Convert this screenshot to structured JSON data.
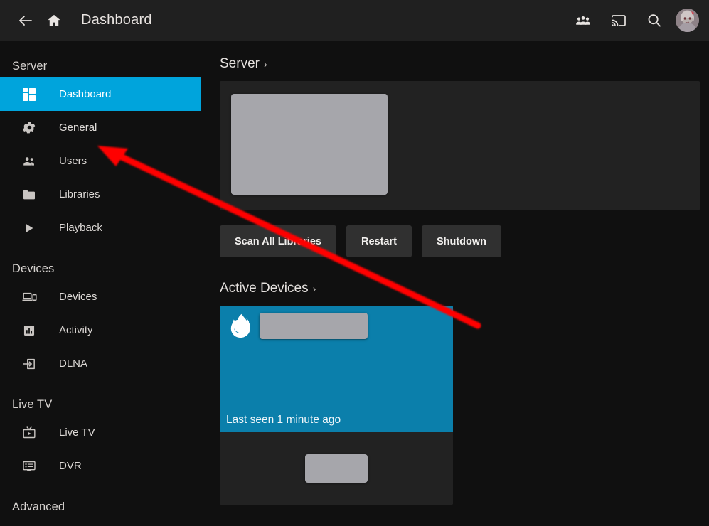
{
  "topbar": {
    "back_icon": "arrow-left-icon",
    "home_icon": "home-icon",
    "title": "Dashboard",
    "actions": [
      {
        "icon": "people-group-icon",
        "name": "group-watch-button"
      },
      {
        "icon": "cast-icon",
        "name": "cast-button"
      },
      {
        "icon": "search-icon",
        "name": "search-button"
      }
    ],
    "avatar_label": "user-avatar"
  },
  "sidebar": {
    "groups": [
      {
        "header": "Server",
        "items": [
          {
            "label": "Dashboard",
            "icon": "dashboard-grid-icon",
            "active": true
          },
          {
            "label": "General",
            "icon": "gear-icon",
            "active": false
          },
          {
            "label": "Users",
            "icon": "people-icon",
            "active": false
          },
          {
            "label": "Libraries",
            "icon": "folder-icon",
            "active": false
          },
          {
            "label": "Playback",
            "icon": "play-icon",
            "active": false
          }
        ]
      },
      {
        "header": "Devices",
        "items": [
          {
            "label": "Devices",
            "icon": "devices-icon",
            "active": false
          },
          {
            "label": "Activity",
            "icon": "activity-chart-icon",
            "active": false
          },
          {
            "label": "DLNA",
            "icon": "dlna-input-icon",
            "active": false
          }
        ]
      },
      {
        "header": "Live TV",
        "items": [
          {
            "label": "Live TV",
            "icon": "live-tv-icon",
            "active": false
          },
          {
            "label": "DVR",
            "icon": "dvr-icon",
            "active": false
          }
        ]
      },
      {
        "header": "Advanced",
        "items": []
      }
    ]
  },
  "main": {
    "server_section": {
      "title": "Server",
      "chevron": "›"
    },
    "buttons": [
      {
        "label": "Scan All Libraries",
        "name": "scan-all-libraries-button"
      },
      {
        "label": "Restart",
        "name": "restart-button"
      },
      {
        "label": "Shutdown",
        "name": "shutdown-button"
      }
    ],
    "devices_section": {
      "title": "Active Devices",
      "chevron": "›"
    },
    "device_card": {
      "client_icon": "firefox-logo-icon",
      "last_seen": "Last seen 1 minute ago"
    }
  },
  "colors": {
    "accent": "#00a4dc",
    "device_card": "#0b7fab",
    "topbar_bg": "#202020",
    "page_bg": "#101010",
    "card_bg": "#222222",
    "button_bg": "#303030",
    "annotation": "#ff0000",
    "redacted": "#a6a6ab"
  }
}
